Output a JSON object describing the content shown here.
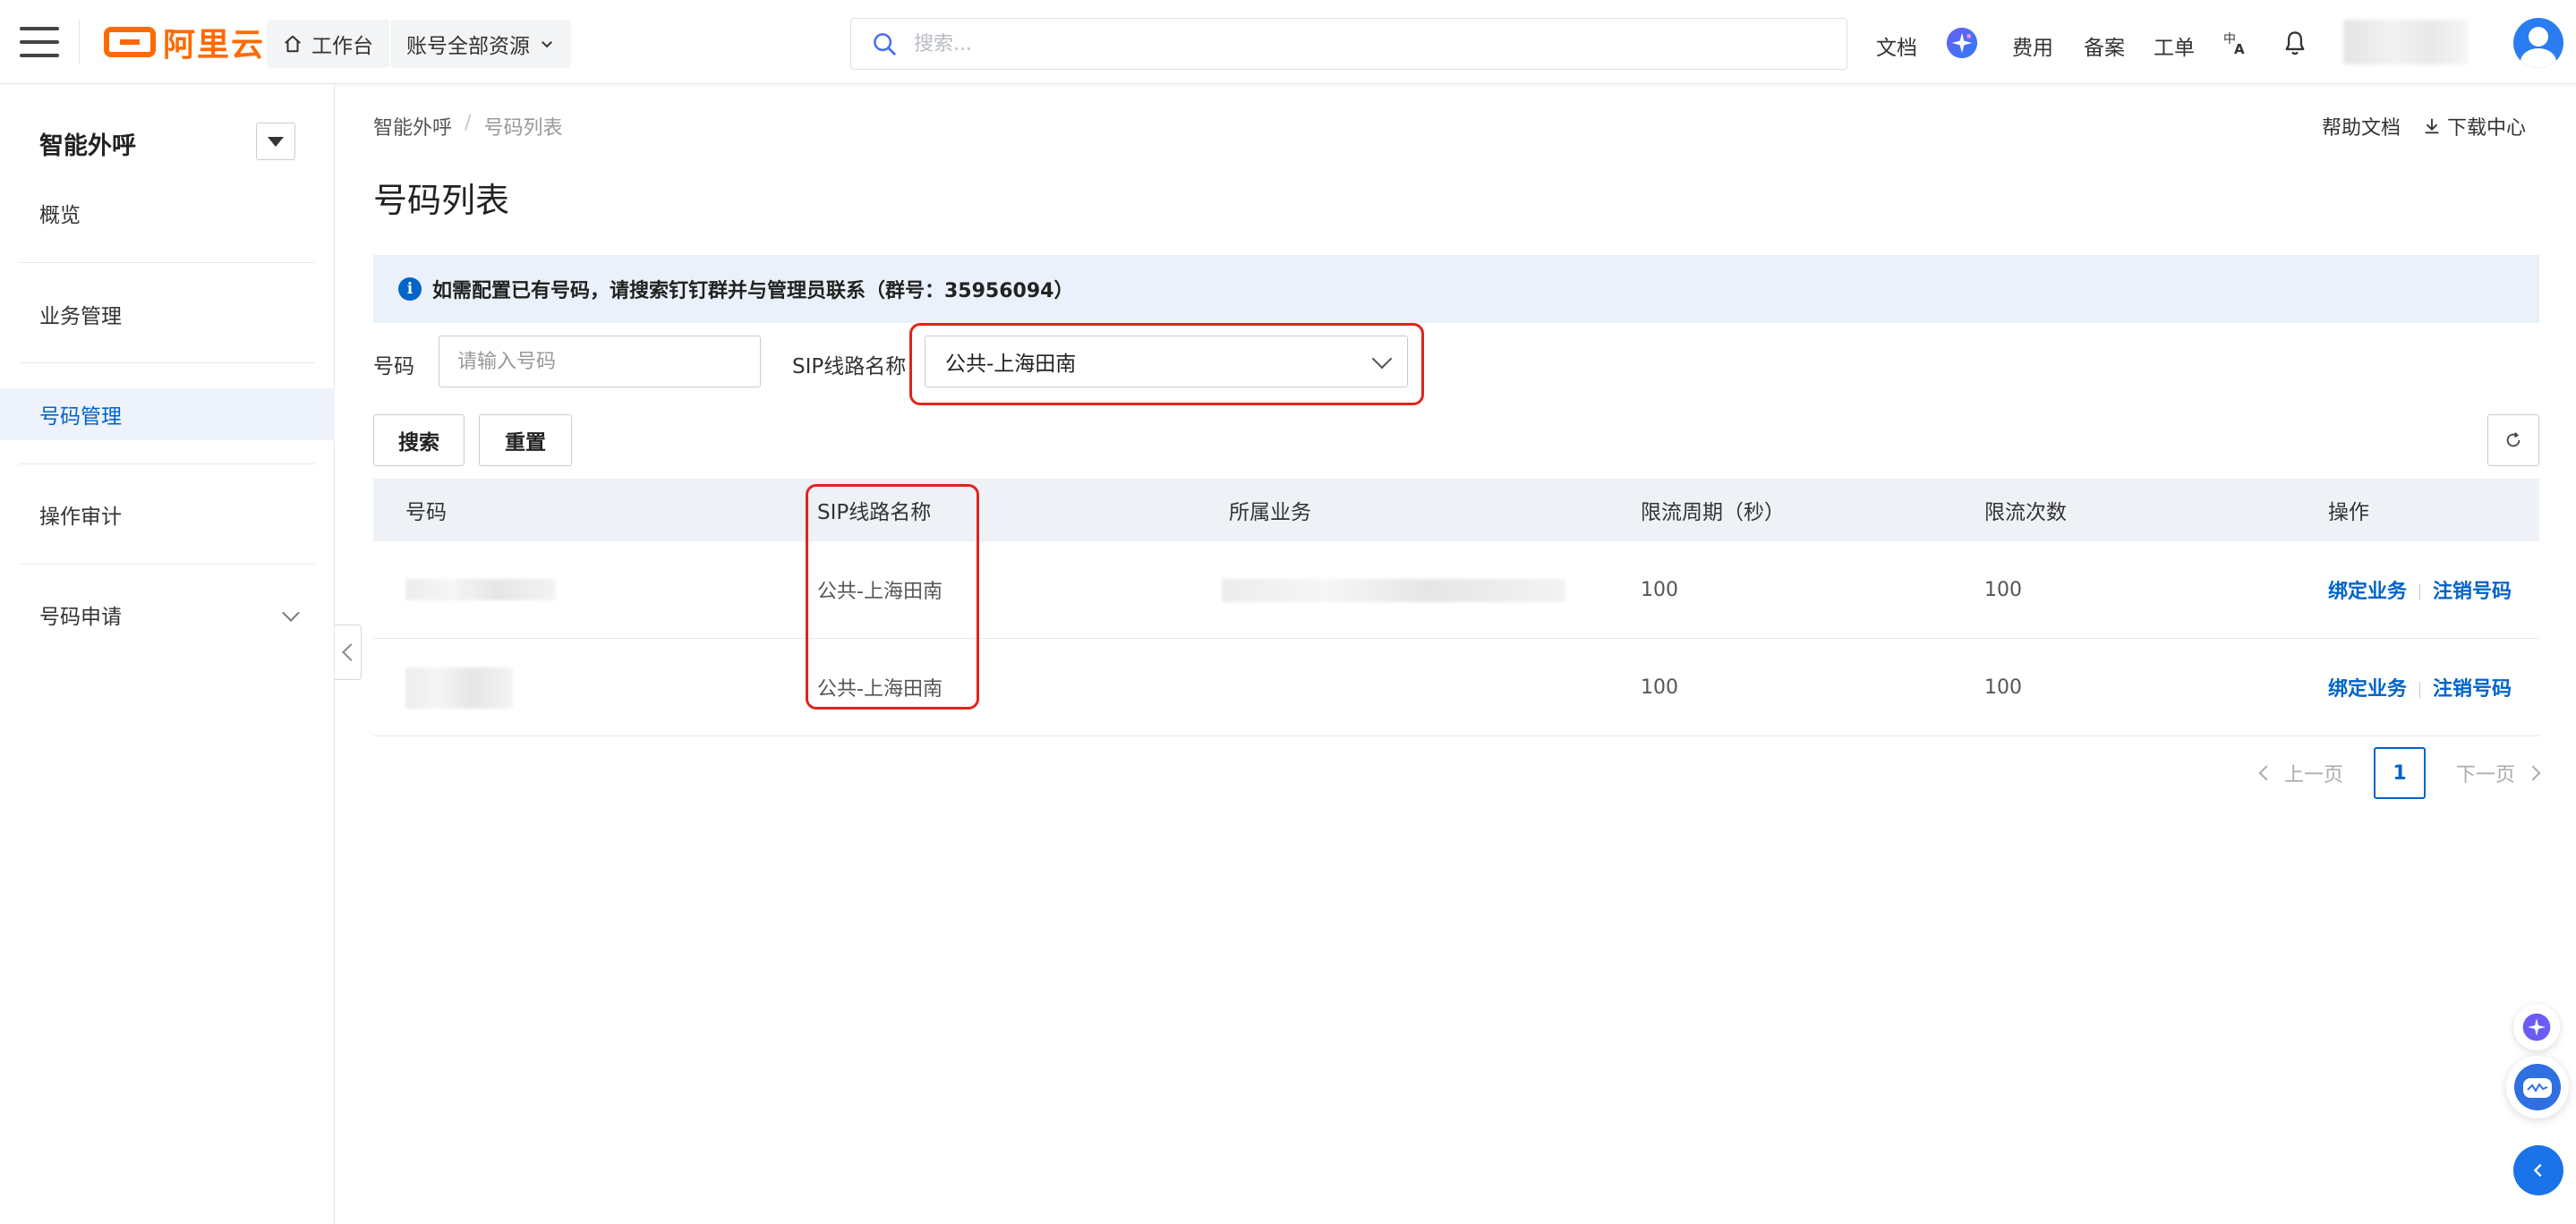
{
  "topbar": {
    "brand": "阿里云",
    "workbench_label": "工作台",
    "resource_scope_label": "账号全部资源",
    "search_placeholder": "搜索...",
    "links": {
      "docs": "文档",
      "billing": "费用",
      "icp": "备案",
      "tickets": "工单"
    }
  },
  "sidebar": {
    "title": "智能外呼",
    "items": [
      {
        "label": "概览",
        "active": false
      },
      {
        "label": "业务管理",
        "active": false
      },
      {
        "label": "号码管理",
        "active": true
      },
      {
        "label": "操作审计",
        "active": false
      },
      {
        "label": "号码申请",
        "active": false,
        "expandable": true
      }
    ]
  },
  "breadcrumb": {
    "parent": "智能外呼",
    "separator": "/",
    "current": "号码列表"
  },
  "header_links": {
    "help_docs": "帮助文档",
    "download_center": "下载中心"
  },
  "page_title": "号码列表",
  "notice": "如需配置已有号码，请搜索钉钉群并与管理员联系（群号：35956094）",
  "filters": {
    "number_label": "号码",
    "number_placeholder": "请输入号码",
    "number_value": "",
    "sip_label": "SIP线路名称",
    "sip_selected": "公共-上海田南"
  },
  "buttons": {
    "search": "搜索",
    "reset": "重置"
  },
  "table": {
    "columns": [
      "号码",
      "SIP线路名称",
      "所属业务",
      "限流周期（秒）",
      "限流次数",
      "操作"
    ],
    "rows": [
      {
        "number": "",
        "sip_line": "公共-上海田南",
        "business": "",
        "period": "100",
        "count": "100",
        "actions": [
          "绑定业务",
          "注销号码"
        ]
      },
      {
        "number": "",
        "sip_line": "公共-上海田南",
        "business": "",
        "period": "100",
        "count": "100",
        "actions": [
          "绑定业务",
          "注销号码"
        ]
      }
    ]
  },
  "pagination": {
    "prev": "上一页",
    "current": "1",
    "next": "下一页"
  },
  "colors": {
    "brand_orange": "#ff6a00",
    "primary_blue": "#0064c8",
    "highlight_red": "#e2231a"
  }
}
